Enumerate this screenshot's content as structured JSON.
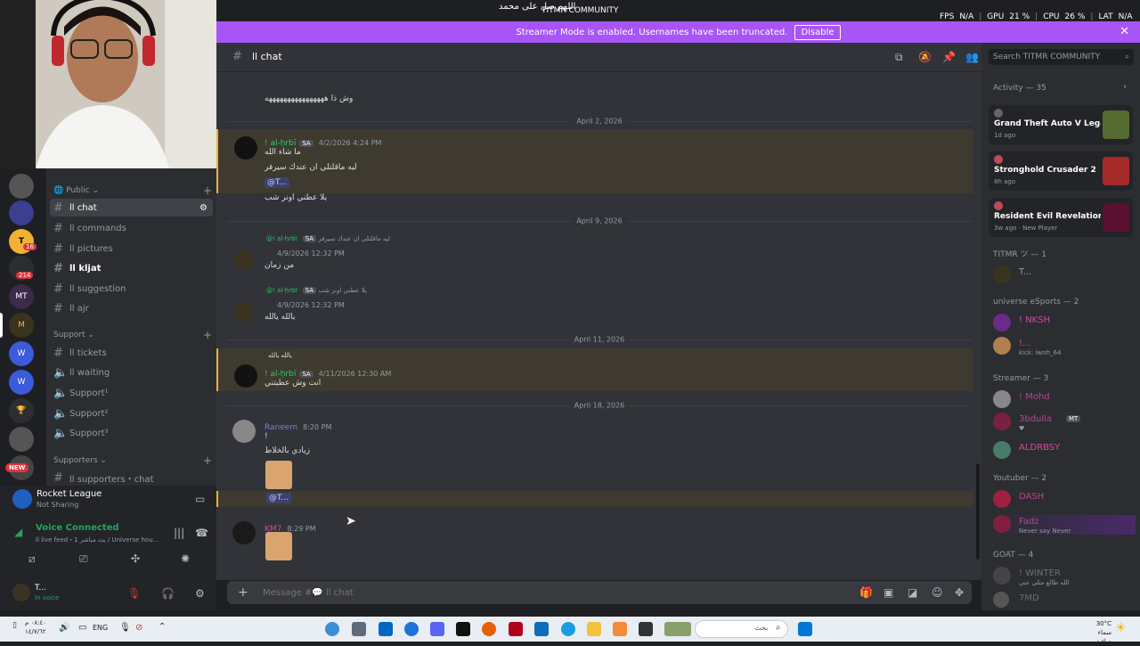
{
  "overlay": {
    "arabic_top": "اللهم صل على محمد",
    "community": "TITMR COMMUNITY",
    "fps_label": "FPS",
    "fps_value": "N/A",
    "gpu_label": "GPU",
    "gpu_value": "21 %",
    "cpu_label": "CPU",
    "cpu_value": "26 %",
    "lat_label": "LAT",
    "lat_value": "N/A"
  },
  "banner": {
    "text": "Streamer Mode is enabled. Usernames have been truncated.",
    "button": "Disable"
  },
  "rail": {
    "badges": [
      "16",
      "214",
      "NEW"
    ]
  },
  "channels": {
    "categories": {
      "public": "Public",
      "support": "Support",
      "supporters": "Supporters"
    },
    "items": [
      {
        "label": "ll chat"
      },
      {
        "label": "ll commands"
      },
      {
        "label": "ll pictures"
      },
      {
        "label": "ll kljat"
      },
      {
        "label": "ll suggestion"
      },
      {
        "label": "ll ajr"
      },
      {
        "label": "ll tickets"
      },
      {
        "label": "ll waiting"
      },
      {
        "label": "Support¹"
      },
      {
        "label": "Support²"
      },
      {
        "label": "Support³"
      },
      {
        "label": "ll supporters・chat"
      }
    ]
  },
  "activity_panel": {
    "game": "Rocket League",
    "status": "Not Sharing"
  },
  "voice": {
    "status": "Voice Connected",
    "detail": "ll live feed・بث مباشر 1 / Universe hou..."
  },
  "user": {
    "name": "T...",
    "status": "In voice"
  },
  "chat": {
    "channel": "ll chat",
    "messages": {
      "m0_text": "وش ذا ههههههههههههههههه",
      "d1": "April 2, 2026",
      "m1_user": "! al-ḥrbī",
      "m1_tag": "SA",
      "m1_time": "4/2/2026 4:24 PM",
      "m1_line1": "ما شاء الله",
      "m1_line2": "ليه ماقلتلي ان عندك سيرفر",
      "m1_mention": "@T...",
      "m1_line3": "يلا عطني اونر شب",
      "d2": "April 9, 2026",
      "m2_reply": "ليه ماقلتلي ان عندك سيرفر",
      "m2_reply_user": "@! al-ḥrbī",
      "m2_time": "4/9/2026 12:32 PM",
      "m2_text": "من زمان",
      "m3_reply": "يلا عطني اونر شب",
      "m3_reply_user": "@! al-ḥrbī",
      "m3_time": "4/9/2026 12:32 PM",
      "m3_text": "يالله يالله",
      "d3": "April 11, 2026",
      "m4_reply": "يالله يالله",
      "m4_user": "! al-ḥrbī",
      "m4_tag": "SA",
      "m4_time": "4/11/2026 12:30 AM",
      "m4_text": "انت وش عطيتني",
      "d4": "April 18, 2026",
      "m5_user": "Raneem",
      "m5_time": "8:20 PM",
      "m5_line1": "!",
      "m5_line2": "زيادي بالخلاط",
      "m5_mention": "@T...",
      "m6_user": "KM7",
      "m6_time": "8:29 PM"
    },
    "composer_placeholder": "Message #💬 ll chat"
  },
  "members": {
    "search_placeholder": "Search TITMR COMMUNITY",
    "activity_header": "Activity — 35",
    "activities": [
      {
        "title": "Grand Theft Auto V Legacy",
        "sub": "1d ago"
      },
      {
        "title": "Stronghold Crusader 2",
        "sub": "8h ago"
      },
      {
        "title": "Resident Evil Revelations 2...",
        "sub": "3w ago · New Player"
      }
    ],
    "groups": {
      "g1": "TITMR ツ — 1",
      "g2": "universe eSports — 2",
      "g3": "Streamer — 3",
      "g4": "Youtuber — 2",
      "g5": "GOAT — 4"
    },
    "people": {
      "p1": "T...",
      "p2": "! NKSH",
      "p3": "!...",
      "p3_status": "kick: iwnh_64",
      "p4": "! Mohd",
      "p5": "3bdulla",
      "p5_tag": "MT",
      "p6": "ALDRBSY",
      "p7": "DASH",
      "p8": "Fadz",
      "p8_status": "Never say Never",
      "p9": "! WINTER",
      "p9_status": "الله طالع مثلي عني",
      "p10": "7MD"
    }
  },
  "taskbar": {
    "time": "٠٨:٤٠ م",
    "date": "١٤/٧/٦٢",
    "lang": "ENG",
    "search": "بحث",
    "weather_temp": "30°C",
    "weather_desc": "سماء صافية"
  },
  "colors": {
    "accent": "#a855f7",
    "online": "#23a55a",
    "mention_bg": "#3c4270",
    "highlight": "#f0b232"
  }
}
